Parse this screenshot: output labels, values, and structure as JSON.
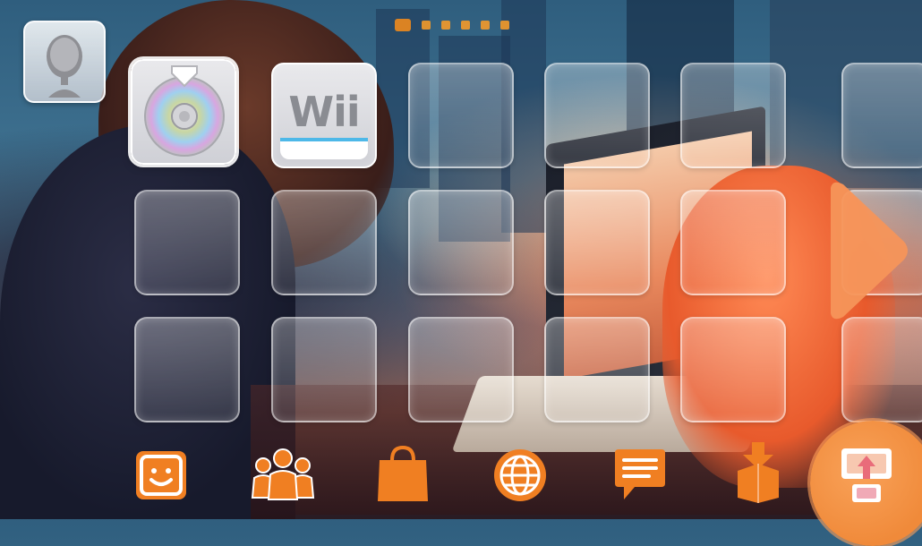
{
  "home": {
    "channel_label": "Wii",
    "page_dots": [
      true,
      false,
      false,
      false,
      false,
      false
    ],
    "accent_color": "#f08a1c"
  },
  "icons": {
    "mii": "mii-avatar-icon",
    "disc": "disc-channel-icon",
    "next": "next-page-arrow-icon",
    "dock": [
      "miiverse-icon",
      "friends-icon",
      "shop-icon",
      "browser-icon",
      "notifications-icon",
      "download-icon",
      "quick-start-icon"
    ]
  }
}
